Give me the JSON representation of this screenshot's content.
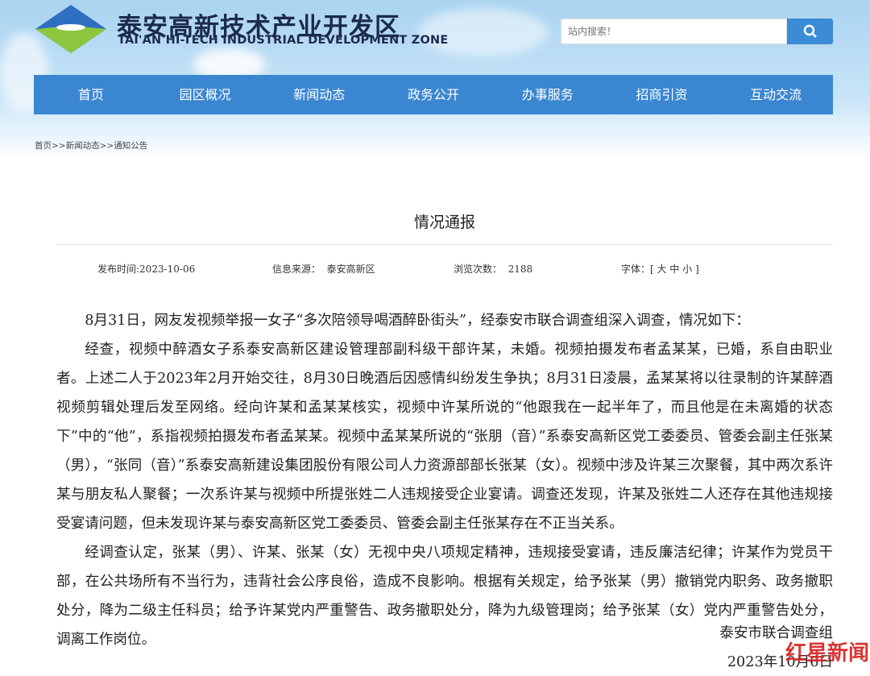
{
  "header": {
    "site_name_cn": "泰安高新技术产业开发区",
    "site_name_en": "TAI'AN HI-TECH INDUSTRIAL DEVELOPMENT ZONE",
    "search_placeholder": "站内搜索！",
    "search_icon": "search-icon"
  },
  "nav": {
    "items": [
      "首页",
      "园区概况",
      "新闻动态",
      "政务公开",
      "办事服务",
      "招商引资",
      "互动交流"
    ]
  },
  "breadcrumb": "首页>>新闻动态>>通知公告",
  "article": {
    "title": "情况通报",
    "publish_time": "发布时间:2023-10-06",
    "source": "信息来源：  泰安高新区",
    "views": "浏览次数：  2188",
    "font_size": "字体：[ 大 中 小 ]",
    "paragraphs": [
      "8月31日，网友发视频举报一女子“多次陪领导喝酒醉卧街头”，经泰安市联合调查组深入调查，情况如下：",
      "经查，视频中醉酒女子系泰安高新区建设管理部副科级干部许某，未婚。视频拍摄发布者孟某某，已婚，系自由职业者。上述二人于2023年2月开始交往，8月30日晚酒后因感情纠纷发生争执；8月31日凌晨，孟某某将以往录制的许某醉酒视频剪辑处理后发至网络。经向许某和孟某某核实，视频中许某所说的“他跟我在一起半年了，而且他是在未离婚的状态下”中的“他”，系指视频拍摄发布者孟某某。视频中孟某某所说的“张朋（音）”系泰安高新区党工委委员、管委会副主任张某（男），“张同（音）”系泰安高新建设集团股份有限公司人力资源部部长张某（女）。视频中涉及许某三次聚餐，其中两次系许某与朋友私人聚餐；一次系许某与视频中所提张姓二人违规接受企业宴请。调查还发现，许某及张姓二人还存在其他违规接受宴请问题，但未发现许某与泰安高新区党工委委员、管委会副主任张某存在不正当关系。",
      "经调查认定，张某（男）、许某、张某（女）无视中央八项规定精神，违规接受宴请，违反廉洁纪律；许某作为党员干部，在公共场所有不当行为，违背社会公序良俗，造成不良影响。根据有关规定，给予张某（男）撤销党内职务、政务撤职处分，降为二级主任科员；给予许某党内严重警告、政务撤职处分，降为九级管理岗；给予张某（女）党内严重警告处分，调离工作岗位。"
    ],
    "signature": "泰安市联合调查组",
    "date": "2023年10月6日"
  },
  "watermark": "红星新闻"
}
